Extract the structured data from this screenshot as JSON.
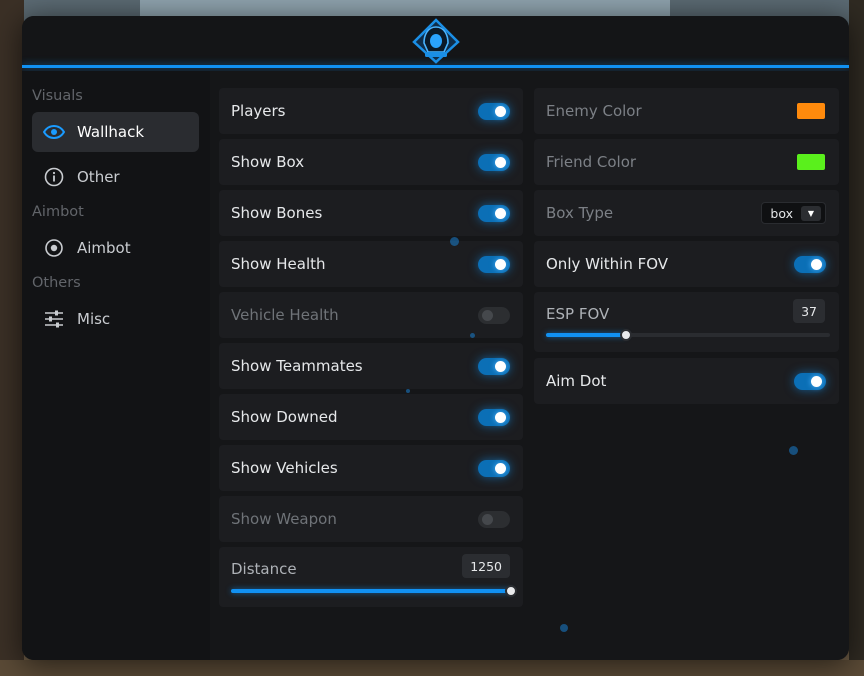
{
  "sidebar": {
    "sections": [
      {
        "title": "Visuals",
        "items": [
          {
            "label": "Wallhack",
            "icon": "eye-icon",
            "active": true
          },
          {
            "label": "Other",
            "icon": "info-icon",
            "active": false
          }
        ]
      },
      {
        "title": "Aimbot",
        "items": [
          {
            "label": "Aimbot",
            "icon": "target-icon",
            "active": false
          }
        ]
      },
      {
        "title": "Others",
        "items": [
          {
            "label": "Misc",
            "icon": "sliders-icon",
            "active": false
          }
        ]
      }
    ]
  },
  "left_column": {
    "toggles": [
      {
        "label": "Players",
        "on": true
      },
      {
        "label": "Show Box",
        "on": true
      },
      {
        "label": "Show Bones",
        "on": true
      },
      {
        "label": "Show Health",
        "on": true
      },
      {
        "label": "Vehicle Health",
        "on": false
      },
      {
        "label": "Show Teammates",
        "on": true
      },
      {
        "label": "Show Downed",
        "on": true
      },
      {
        "label": "Show Vehicles",
        "on": true
      },
      {
        "label": "Show Weapon",
        "on": false
      }
    ],
    "distance": {
      "label": "Distance",
      "value": "1250",
      "fraction": 1.0
    }
  },
  "right_column": {
    "enemy_color": {
      "label": "Enemy Color",
      "color": "#ff8a0c"
    },
    "friend_color": {
      "label": "Friend Color",
      "color": "#5af01c"
    },
    "box_type": {
      "label": "Box Type",
      "value": "box"
    },
    "only_within_fov": {
      "label": "Only Within FOV",
      "on": true
    },
    "esp_fov": {
      "label": "ESP FOV",
      "value": "37",
      "fraction": 0.28
    },
    "aim_dot": {
      "label": "Aim Dot",
      "on": true
    }
  },
  "colors": {
    "accent": "#1191f2",
    "panel": "#151618",
    "row": "#1c1d20"
  }
}
